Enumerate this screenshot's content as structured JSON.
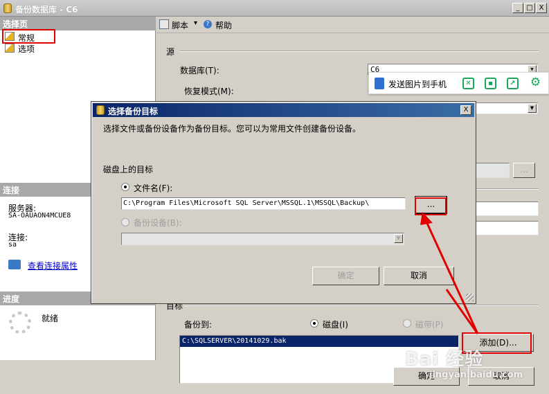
{
  "window": {
    "title": "备份数据库 - C6",
    "minimize": "_",
    "maximize": "□",
    "close": "X"
  },
  "left": {
    "select_page_header": "选择页",
    "pages": [
      {
        "label": "常规",
        "icon": "page-icon"
      },
      {
        "label": "选项",
        "icon": "page-icon"
      }
    ],
    "connection_header": "连接",
    "server_label": "服务器:",
    "server_value": "SA-OAUAON4MCUE8",
    "connection_label": "连接:",
    "connection_value": "sa",
    "view_conn_props": "查看连接属性",
    "progress_header": "进度",
    "progress_status": "就绪"
  },
  "toolbar": {
    "script_label": "脚本",
    "script_arrow": "▾",
    "help_label": "帮助"
  },
  "main": {
    "source_group": "源",
    "database_label": "数据库(T):",
    "database_value": "C6",
    "recovery_label": "恢复模式(M):",
    "target_group": "目标",
    "backup_to_label": "备份到:",
    "disk_label": "磁盘(I)",
    "tape_label": "磁带(P)",
    "backup_path": "C:\\SQLSERVER\\20141029.bak",
    "add_button": "添加(D)...",
    "small_browse": "...",
    "ok_button": "确定",
    "cancel_button": "取消"
  },
  "phone_toolbar": {
    "send_label": "发送图片到手机"
  },
  "dialog": {
    "title": "选择备份目标",
    "close": "X",
    "description": "选择文件或备份设备作为备份目标。您可以为常用文件创建备份设备。",
    "disk_target_label": "磁盘上的目标",
    "filename_label": "文件名(F):",
    "filename_value": "C:\\Program Files\\Microsoft SQL Server\\MSSQL.1\\MSSQL\\Backup\\",
    "browse_button": "...",
    "device_label": "备份设备(B):",
    "ok_button": "确定",
    "cancel_button": "取消"
  },
  "watermark": {
    "brand": "Bai  经验",
    "url": "jingyan.baidu.com"
  },
  "colors": {
    "dialog_title": "#0a246a",
    "selection": "#0a246a",
    "highlight_red": "#e00000",
    "link": "#0000cc"
  }
}
